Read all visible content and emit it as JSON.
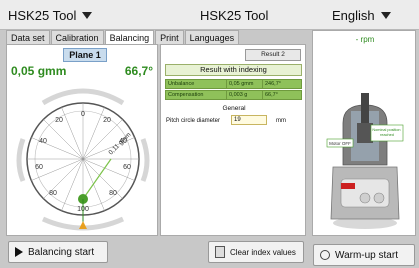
{
  "header": {
    "tool_select": "HSK25 Tool",
    "title": "HSK25 Tool",
    "language": "English"
  },
  "tabs": [
    "Data set",
    "Calibration",
    "Balancing",
    "Print",
    "Languages"
  ],
  "plane": {
    "label": "Plane 1",
    "gmm": "0,05 gmm",
    "angle": "66,7°",
    "vector_label": "0,11 gmm",
    "scale_labels": [
      "0",
      "20",
      "40",
      "60",
      "80",
      "100",
      "80",
      "60",
      "40",
      "20"
    ]
  },
  "results": {
    "result_button": "Result 2",
    "title": "Result with indexing",
    "rows": [
      {
        "label": "Unbalance",
        "v1": "0,05 gmm",
        "v2": "246,7°"
      },
      {
        "label": "Compensation",
        "v1": "0,003 g",
        "v2": "66,7°"
      }
    ],
    "general": "General",
    "pitch_label": "Pitch circle diameter",
    "pitch_value": "19",
    "pitch_unit": "mm"
  },
  "side": {
    "rpm": "- rpm",
    "motor_label": "Motor OFF",
    "nominal_label": "Nominal position reached"
  },
  "buttons": {
    "balancing_start": "Balancing start",
    "clear_index": "Clear index values",
    "warm_up": "Warm-up start"
  },
  "colors": {
    "accent_green": "#2e8b1f",
    "table_green": "#8fc15a"
  }
}
